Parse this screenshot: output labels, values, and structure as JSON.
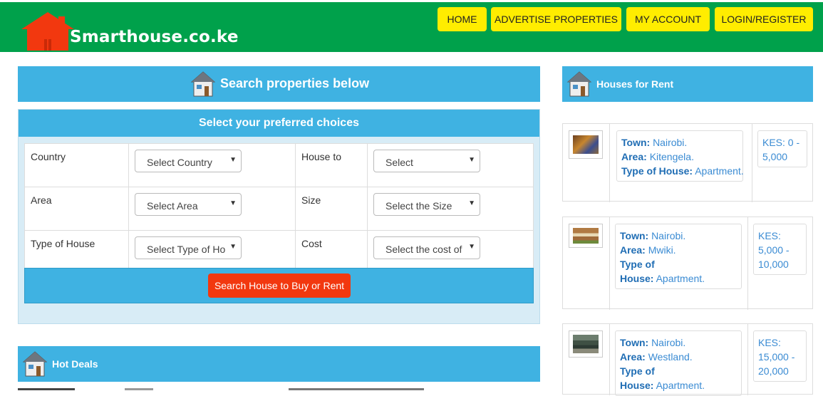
{
  "brand": {
    "name": "Smarthouse.co.ke",
    "logo_color": "#f2380f",
    "header_bg": "#00a14b"
  },
  "nav": [
    {
      "label": "HOME"
    },
    {
      "label": "ADVERTISE PROPERTIES"
    },
    {
      "label": "MY ACCOUNT"
    },
    {
      "label": "LOGIN/REGISTER"
    }
  ],
  "search": {
    "title": "Search properties below",
    "subtitle": "Select your preferred choices",
    "fields": {
      "country": {
        "label": "Country",
        "value": "Select Country"
      },
      "house_to": {
        "label": "House to",
        "value": "Select"
      },
      "area": {
        "label": "Area",
        "value": "Select Area"
      },
      "size": {
        "label": "Size",
        "value": "Select the Size"
      },
      "type": {
        "label": "Type of House",
        "value": "Select Type of Ho"
      },
      "cost": {
        "label": "Cost",
        "value": "Select the cost of"
      }
    },
    "button": "Search House to Buy or Rent"
  },
  "hot_deals": {
    "title": "Hot Deals"
  },
  "rentals": {
    "title": "Houses for Rent",
    "town_label": "Town:",
    "area_label": "Area:",
    "type_label_1": "Type of",
    "type_label_2": "House:",
    "type_label_full": "Type of House:",
    "items": [
      {
        "town": "Nairobi.",
        "area": "Kitengela.",
        "type": "Apartment.",
        "price_1": "KES: 0 -",
        "price_2": "5,000"
      },
      {
        "town": "Nairobi.",
        "area": "Mwiki.",
        "type": "Apartment.",
        "price_1": "KES:",
        "price_2": "5,000 -",
        "price_3": "10,000"
      },
      {
        "town": "Nairobi.",
        "area": "Westland.",
        "type": "Apartment.",
        "price_1": "KES:",
        "price_2": "15,000 -",
        "price_3": "20,000"
      }
    ]
  },
  "colors": {
    "accent": "#3fb2e2",
    "nav_bg": "#ffed00",
    "button": "#f2380f",
    "link": "#3a8bd3"
  },
  "icons": {
    "logo": "house-logo-icon",
    "section": "house-icon"
  }
}
